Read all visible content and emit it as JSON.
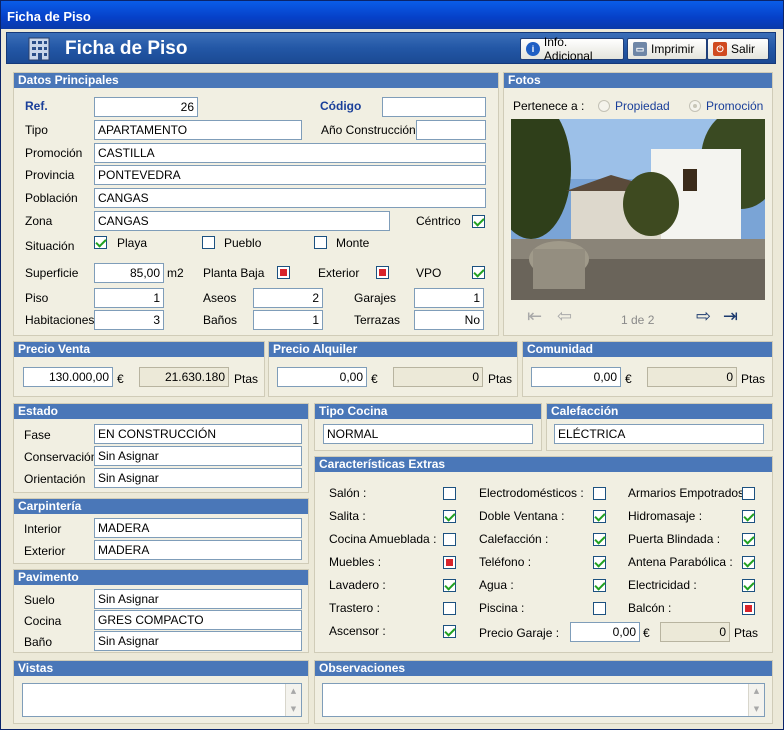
{
  "window": {
    "title": "Ficha de Piso"
  },
  "header": {
    "title": "Ficha de Piso",
    "btn_info": "Info. Adicional",
    "btn_print": "Imprimir",
    "btn_exit": "Salir"
  },
  "datos": {
    "title": "Datos Principales",
    "ref_label": "Ref.",
    "ref": "26",
    "codigo_label": "Código",
    "codigo": "",
    "tipo_label": "Tipo",
    "tipo": "APARTAMENTO",
    "anio_label": "Año Construcción",
    "anio": "",
    "promocion_label": "Promoción",
    "promocion": "CASTILLA",
    "provincia_label": "Provincia",
    "provincia": "PONTEVEDRA",
    "poblacion_label": "Población",
    "poblacion": "CANGAS",
    "zona_label": "Zona",
    "zona": "CANGAS",
    "centrico_label": "Céntrico",
    "centrico": true,
    "situacion_label": "Situación",
    "playa_label": "Playa",
    "playa": true,
    "pueblo_label": "Pueblo",
    "pueblo": false,
    "monte_label": "Monte",
    "monte": false,
    "superficie_label": "Superficie",
    "superficie": "85,00",
    "m2": "m2",
    "planta_baja_label": "Planta Baja",
    "exterior_label": "Exterior",
    "vpo_label": "VPO",
    "piso_label": "Piso",
    "piso": "1",
    "aseos_label": "Aseos",
    "aseos": "2",
    "garajes_label": "Garajes",
    "garajes": "1",
    "habitaciones_label": "Habitaciones",
    "habitaciones": "3",
    "banos_label": "Baños",
    "banos": "1",
    "terrazas_label": "Terrazas",
    "terrazas": "No"
  },
  "fotos": {
    "title": "Fotos",
    "pertenece_label": "Pertenece a :",
    "propiedad_label": "Propiedad",
    "promocion_label": "Promoción",
    "counter": "1 de 2"
  },
  "precio_venta": {
    "title": "Precio Venta",
    "euros": "130.000,00",
    "euro_sym": "€",
    "ptas": "21.630.180",
    "ptas_label": "Ptas"
  },
  "precio_alquiler": {
    "title": "Precio Alquiler",
    "euros": "0,00",
    "euro_sym": "€",
    "ptas": "0",
    "ptas_label": "Ptas"
  },
  "comunidad": {
    "title": "Comunidad",
    "euros": "0,00",
    "euro_sym": "€",
    "ptas": "0",
    "ptas_label": "Ptas"
  },
  "estado": {
    "title": "Estado",
    "fase_label": "Fase",
    "fase": "EN CONSTRUCCIÓN",
    "conservacion_label": "Conservación",
    "conservacion": "Sin Asignar",
    "orientacion_label": "Orientación",
    "orientacion": "Sin Asignar"
  },
  "tipo_cocina": {
    "title": "Tipo Cocina",
    "value": "NORMAL"
  },
  "calefaccion": {
    "title": "Calefacción",
    "value": "ELÉCTRICA"
  },
  "carpinteria": {
    "title": "Carpintería",
    "interior_label": "Interior",
    "interior": "MADERA",
    "exterior_label": "Exterior",
    "exterior": "MADERA"
  },
  "pavimento": {
    "title": "Pavimento",
    "suelo_label": "Suelo",
    "suelo": "Sin Asignar",
    "cocina_label": "Cocina",
    "cocina": "GRES COMPACTO",
    "bano_label": "Baño",
    "bano": "Sin Asignar"
  },
  "extras": {
    "title": "Características Extras",
    "col1": [
      {
        "label": "Salón :",
        "state": "off"
      },
      {
        "label": "Salita :",
        "state": "on"
      },
      {
        "label": "Cocina Amueblada :",
        "state": "off"
      },
      {
        "label": "Muebles :",
        "state": "red"
      },
      {
        "label": "Lavadero :",
        "state": "on"
      },
      {
        "label": "Trastero :",
        "state": "off"
      },
      {
        "label": "Ascensor :",
        "state": "on"
      }
    ],
    "col2": [
      {
        "label": "Electrodomésticos :",
        "state": "off"
      },
      {
        "label": "Doble Ventana :",
        "state": "on"
      },
      {
        "label": "Calefacción :",
        "state": "on"
      },
      {
        "label": "Teléfono :",
        "state": "on"
      },
      {
        "label": "Agua :",
        "state": "on"
      },
      {
        "label": "Piscina :",
        "state": "off"
      }
    ],
    "col3": [
      {
        "label": "Armarios Empotrados :",
        "state": "off"
      },
      {
        "label": "Hidromasaje :",
        "state": "on"
      },
      {
        "label": "Puerta Blindada :",
        "state": "on"
      },
      {
        "label": "Antena Parabólica :",
        "state": "on"
      },
      {
        "label": "Electricidad :",
        "state": "on"
      },
      {
        "label": "Balcón :",
        "state": "red"
      }
    ],
    "precio_garaje_label": "Precio Garaje :",
    "precio_garaje": "0,00",
    "euro_sym": "€",
    "garaje_ptas": "0",
    "ptas_label": "Ptas"
  },
  "vistas": {
    "title": "Vistas"
  },
  "observaciones": {
    "title": "Observaciones"
  }
}
